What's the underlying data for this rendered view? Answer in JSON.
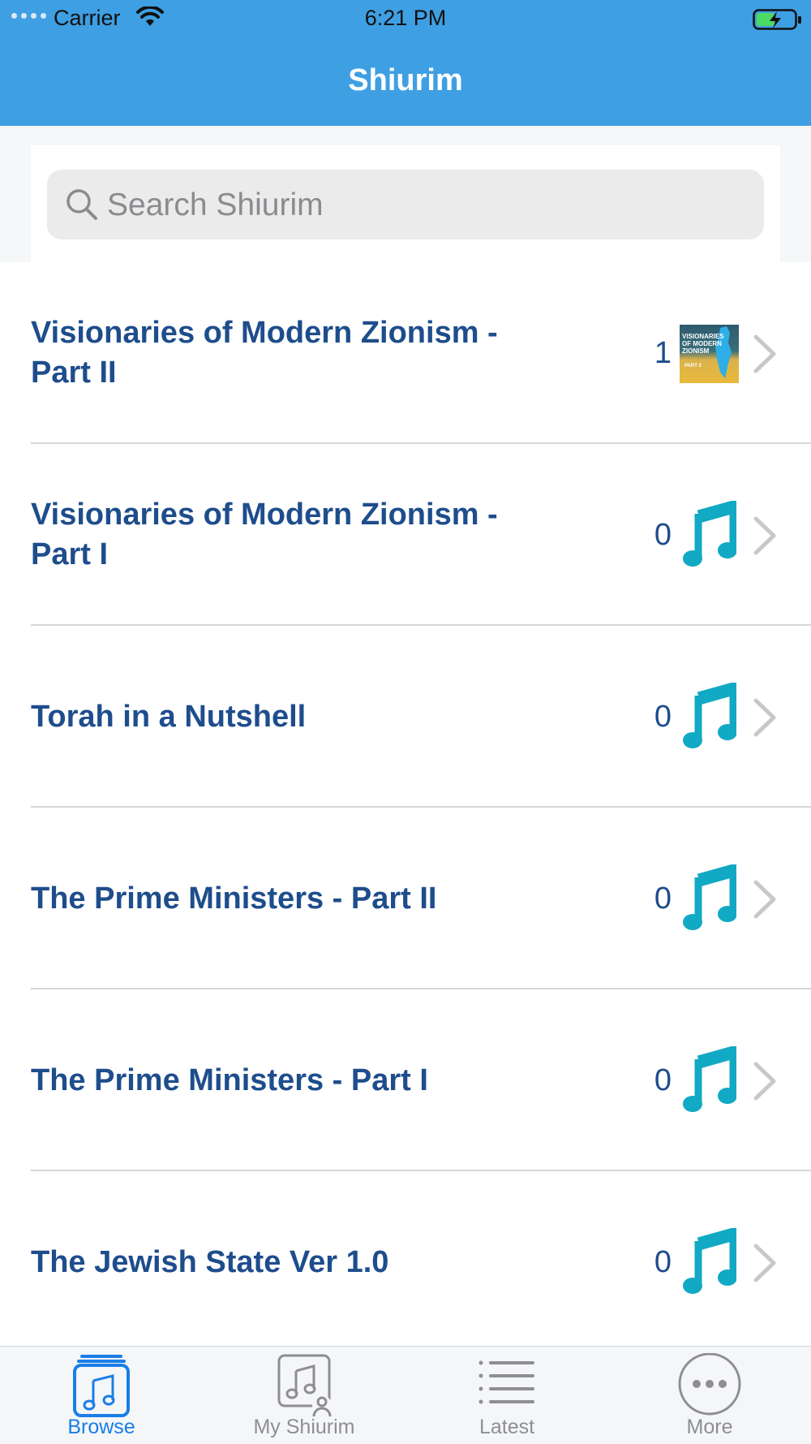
{
  "status_bar": {
    "carrier": "Carrier",
    "time": "6:21 PM"
  },
  "nav": {
    "title": "Shiurim"
  },
  "search": {
    "placeholder": "Search Shiurim"
  },
  "list": {
    "items": [
      {
        "title": "Visionaries of Modern Zionism - Part II",
        "count": "1",
        "icon": "thumbnail-image",
        "thumb_text": [
          "VISIONARIES",
          "OF MODERN",
          "ZIONISM",
          "PART 2"
        ]
      },
      {
        "title": "Visionaries of Modern Zionism - Part I",
        "count": "0",
        "icon": "music-note-icon"
      },
      {
        "title": "Torah in a Nutshell",
        "count": "0",
        "icon": "music-note-icon"
      },
      {
        "title": "The Prime Ministers - Part II",
        "count": "0",
        "icon": "music-note-icon"
      },
      {
        "title": "The Prime Ministers - Part I",
        "count": "0",
        "icon": "music-note-icon"
      },
      {
        "title": "The Jewish State Ver 1.0",
        "count": "0",
        "icon": "music-note-icon"
      }
    ]
  },
  "tabs": [
    {
      "label": "Browse",
      "icon": "music-box-icon",
      "active": true
    },
    {
      "label": "My Shiurim",
      "icon": "my-music-icon",
      "active": false
    },
    {
      "label": "Latest",
      "icon": "list-icon",
      "active": false
    },
    {
      "label": "More",
      "icon": "more-icon",
      "active": false
    }
  ],
  "colors": {
    "header": "#3f9fe3",
    "title_text": "#1e4d8c",
    "note_icon": "#12a9c4",
    "active_tab": "#1a7ee6"
  }
}
